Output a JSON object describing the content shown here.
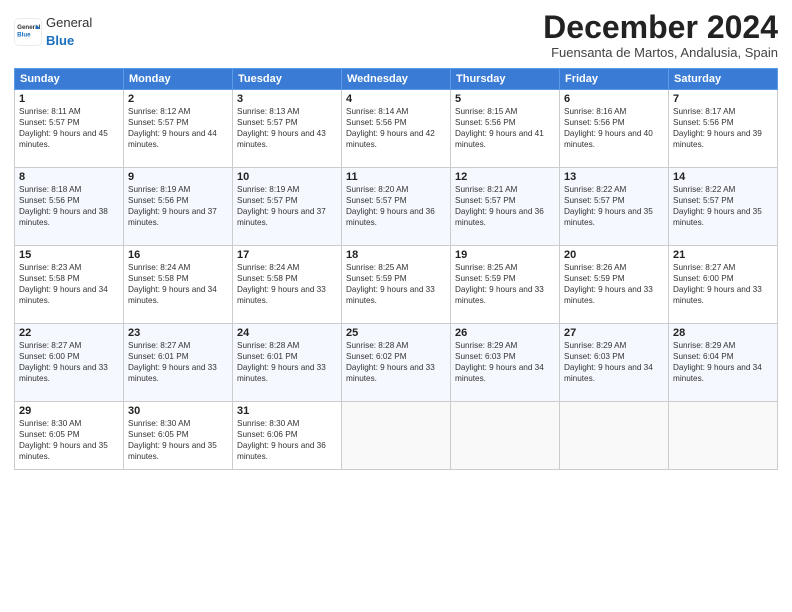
{
  "header": {
    "logo_general": "General",
    "logo_blue": "Blue",
    "month_title": "December 2024",
    "location": "Fuensanta de Martos, Andalusia, Spain"
  },
  "weekdays": [
    "Sunday",
    "Monday",
    "Tuesday",
    "Wednesday",
    "Thursday",
    "Friday",
    "Saturday"
  ],
  "weeks": [
    [
      {
        "day": "1",
        "sunrise": "Sunrise: 8:11 AM",
        "sunset": "Sunset: 5:57 PM",
        "daylight": "Daylight: 9 hours and 45 minutes."
      },
      {
        "day": "2",
        "sunrise": "Sunrise: 8:12 AM",
        "sunset": "Sunset: 5:57 PM",
        "daylight": "Daylight: 9 hours and 44 minutes."
      },
      {
        "day": "3",
        "sunrise": "Sunrise: 8:13 AM",
        "sunset": "Sunset: 5:57 PM",
        "daylight": "Daylight: 9 hours and 43 minutes."
      },
      {
        "day": "4",
        "sunrise": "Sunrise: 8:14 AM",
        "sunset": "Sunset: 5:56 PM",
        "daylight": "Daylight: 9 hours and 42 minutes."
      },
      {
        "day": "5",
        "sunrise": "Sunrise: 8:15 AM",
        "sunset": "Sunset: 5:56 PM",
        "daylight": "Daylight: 9 hours and 41 minutes."
      },
      {
        "day": "6",
        "sunrise": "Sunrise: 8:16 AM",
        "sunset": "Sunset: 5:56 PM",
        "daylight": "Daylight: 9 hours and 40 minutes."
      },
      {
        "day": "7",
        "sunrise": "Sunrise: 8:17 AM",
        "sunset": "Sunset: 5:56 PM",
        "daylight": "Daylight: 9 hours and 39 minutes."
      }
    ],
    [
      {
        "day": "8",
        "sunrise": "Sunrise: 8:18 AM",
        "sunset": "Sunset: 5:56 PM",
        "daylight": "Daylight: 9 hours and 38 minutes."
      },
      {
        "day": "9",
        "sunrise": "Sunrise: 8:19 AM",
        "sunset": "Sunset: 5:56 PM",
        "daylight": "Daylight: 9 hours and 37 minutes."
      },
      {
        "day": "10",
        "sunrise": "Sunrise: 8:19 AM",
        "sunset": "Sunset: 5:57 PM",
        "daylight": "Daylight: 9 hours and 37 minutes."
      },
      {
        "day": "11",
        "sunrise": "Sunrise: 8:20 AM",
        "sunset": "Sunset: 5:57 PM",
        "daylight": "Daylight: 9 hours and 36 minutes."
      },
      {
        "day": "12",
        "sunrise": "Sunrise: 8:21 AM",
        "sunset": "Sunset: 5:57 PM",
        "daylight": "Daylight: 9 hours and 36 minutes."
      },
      {
        "day": "13",
        "sunrise": "Sunrise: 8:22 AM",
        "sunset": "Sunset: 5:57 PM",
        "daylight": "Daylight: 9 hours and 35 minutes."
      },
      {
        "day": "14",
        "sunrise": "Sunrise: 8:22 AM",
        "sunset": "Sunset: 5:57 PM",
        "daylight": "Daylight: 9 hours and 35 minutes."
      }
    ],
    [
      {
        "day": "15",
        "sunrise": "Sunrise: 8:23 AM",
        "sunset": "Sunset: 5:58 PM",
        "daylight": "Daylight: 9 hours and 34 minutes."
      },
      {
        "day": "16",
        "sunrise": "Sunrise: 8:24 AM",
        "sunset": "Sunset: 5:58 PM",
        "daylight": "Daylight: 9 hours and 34 minutes."
      },
      {
        "day": "17",
        "sunrise": "Sunrise: 8:24 AM",
        "sunset": "Sunset: 5:58 PM",
        "daylight": "Daylight: 9 hours and 33 minutes."
      },
      {
        "day": "18",
        "sunrise": "Sunrise: 8:25 AM",
        "sunset": "Sunset: 5:59 PM",
        "daylight": "Daylight: 9 hours and 33 minutes."
      },
      {
        "day": "19",
        "sunrise": "Sunrise: 8:25 AM",
        "sunset": "Sunset: 5:59 PM",
        "daylight": "Daylight: 9 hours and 33 minutes."
      },
      {
        "day": "20",
        "sunrise": "Sunrise: 8:26 AM",
        "sunset": "Sunset: 5:59 PM",
        "daylight": "Daylight: 9 hours and 33 minutes."
      },
      {
        "day": "21",
        "sunrise": "Sunrise: 8:27 AM",
        "sunset": "Sunset: 6:00 PM",
        "daylight": "Daylight: 9 hours and 33 minutes."
      }
    ],
    [
      {
        "day": "22",
        "sunrise": "Sunrise: 8:27 AM",
        "sunset": "Sunset: 6:00 PM",
        "daylight": "Daylight: 9 hours and 33 minutes."
      },
      {
        "day": "23",
        "sunrise": "Sunrise: 8:27 AM",
        "sunset": "Sunset: 6:01 PM",
        "daylight": "Daylight: 9 hours and 33 minutes."
      },
      {
        "day": "24",
        "sunrise": "Sunrise: 8:28 AM",
        "sunset": "Sunset: 6:01 PM",
        "daylight": "Daylight: 9 hours and 33 minutes."
      },
      {
        "day": "25",
        "sunrise": "Sunrise: 8:28 AM",
        "sunset": "Sunset: 6:02 PM",
        "daylight": "Daylight: 9 hours and 33 minutes."
      },
      {
        "day": "26",
        "sunrise": "Sunrise: 8:29 AM",
        "sunset": "Sunset: 6:03 PM",
        "daylight": "Daylight: 9 hours and 34 minutes."
      },
      {
        "day": "27",
        "sunrise": "Sunrise: 8:29 AM",
        "sunset": "Sunset: 6:03 PM",
        "daylight": "Daylight: 9 hours and 34 minutes."
      },
      {
        "day": "28",
        "sunrise": "Sunrise: 8:29 AM",
        "sunset": "Sunset: 6:04 PM",
        "daylight": "Daylight: 9 hours and 34 minutes."
      }
    ],
    [
      {
        "day": "29",
        "sunrise": "Sunrise: 8:30 AM",
        "sunset": "Sunset: 6:05 PM",
        "daylight": "Daylight: 9 hours and 35 minutes."
      },
      {
        "day": "30",
        "sunrise": "Sunrise: 8:30 AM",
        "sunset": "Sunset: 6:05 PM",
        "daylight": "Daylight: 9 hours and 35 minutes."
      },
      {
        "day": "31",
        "sunrise": "Sunrise: 8:30 AM",
        "sunset": "Sunset: 6:06 PM",
        "daylight": "Daylight: 9 hours and 36 minutes."
      },
      null,
      null,
      null,
      null
    ]
  ]
}
